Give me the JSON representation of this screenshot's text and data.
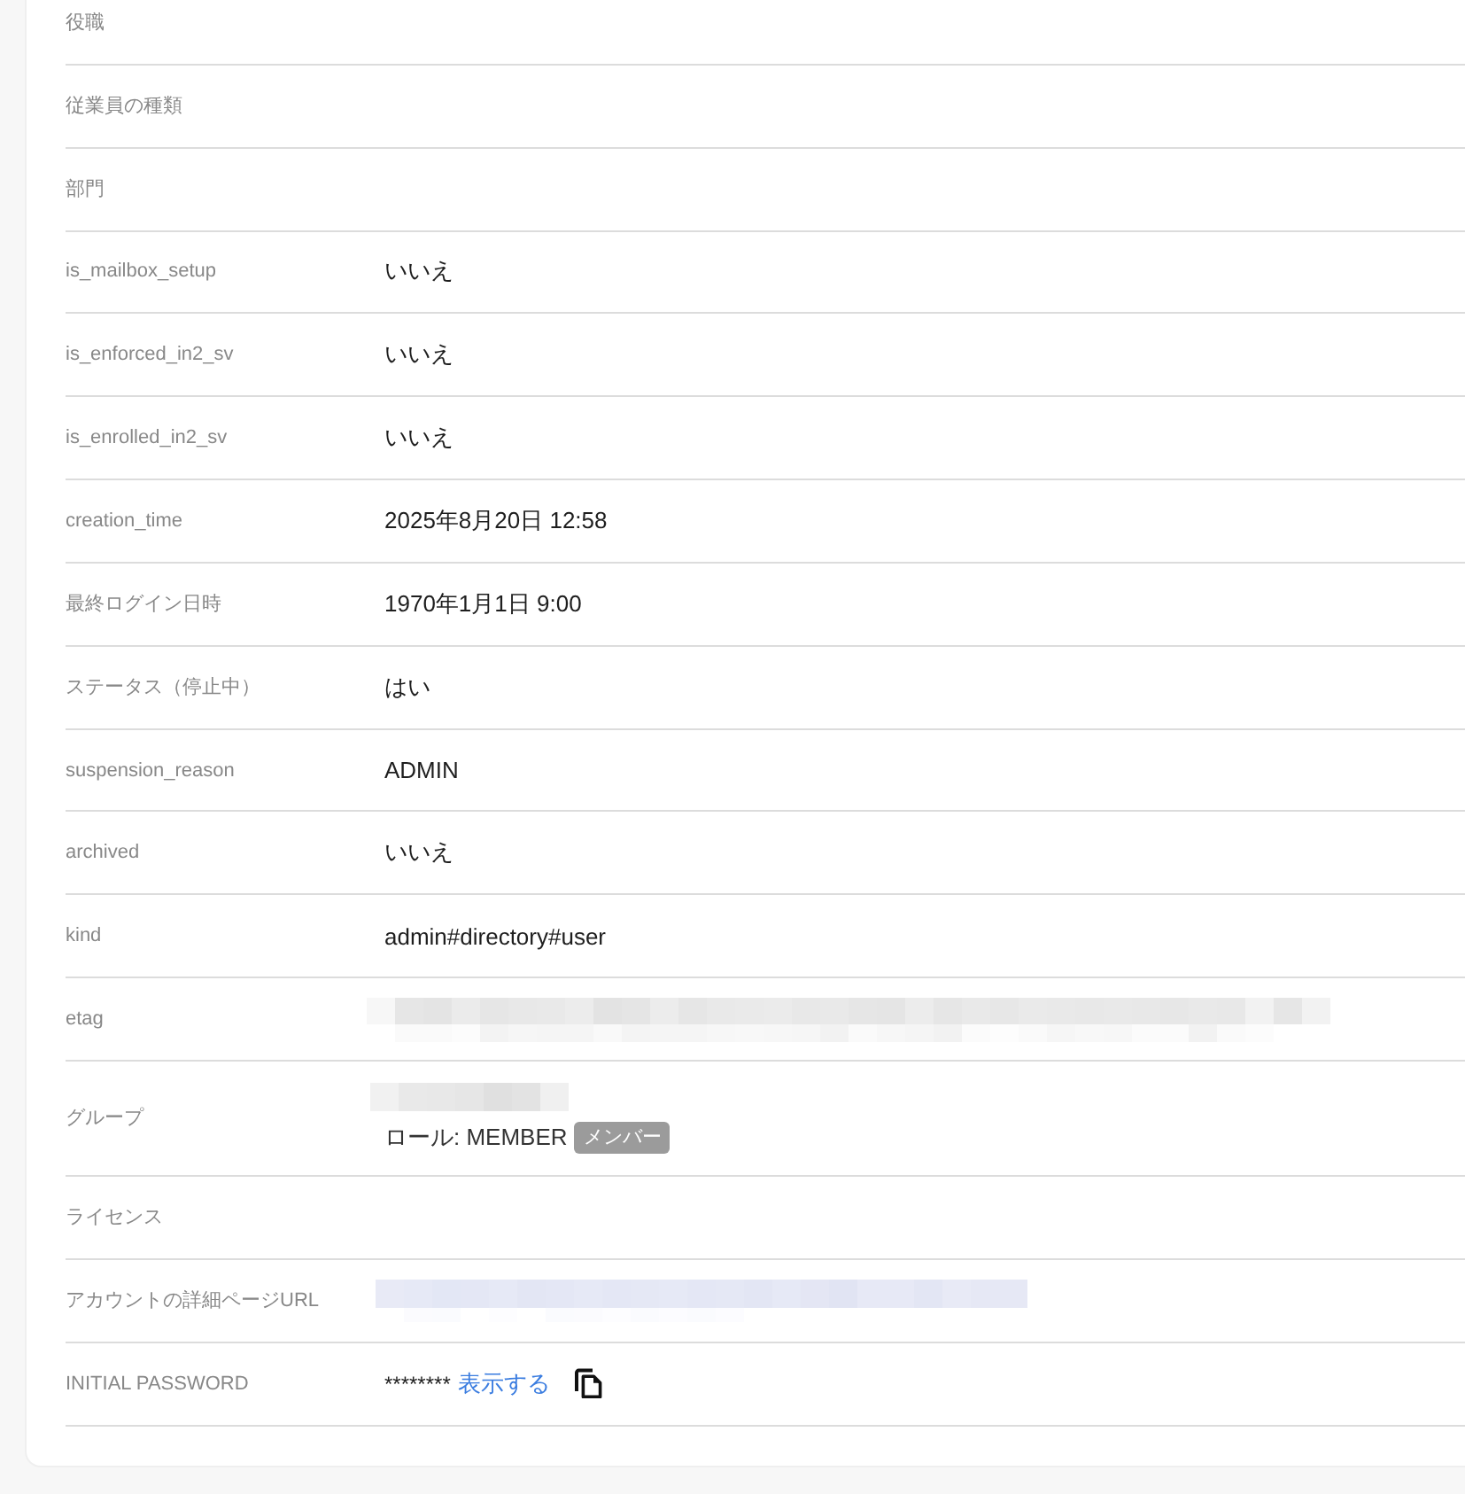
{
  "rows": [
    {
      "kind": "text",
      "label": "役職"
    },
    {
      "kind": "text",
      "label": "従業員の種類"
    },
    {
      "kind": "text",
      "label": "部門"
    },
    {
      "kind": "text",
      "label": "is_mailbox_setup",
      "value": "いいえ"
    },
    {
      "kind": "text",
      "label": "is_enforced_in2_sv",
      "value": "いいえ"
    },
    {
      "kind": "text",
      "label": "is_enrolled_in2_sv",
      "value": "いいえ"
    },
    {
      "kind": "text",
      "label": "creation_time",
      "value": "2025年8月20日 12:58"
    },
    {
      "kind": "text",
      "label": "最終ログイン日時",
      "value": "1970年1月1日 9:00"
    },
    {
      "kind": "text",
      "label": "ステータス（停止中）",
      "value": "はい"
    },
    {
      "kind": "text",
      "label": "suspension_reason",
      "value": "ADMIN"
    },
    {
      "kind": "text",
      "label": "archived",
      "value": "いいえ"
    },
    {
      "kind": "text",
      "label": "kind",
      "value": "admin#directory#user"
    },
    {
      "kind": "blur",
      "label": "etag"
    },
    {
      "kind": "group",
      "label": "グループ",
      "role": "ロール: MEMBER",
      "badge": "メンバー"
    },
    {
      "kind": "text",
      "label": "ライセンス"
    },
    {
      "kind": "url",
      "label": "アカウントの詳細ページURL"
    },
    {
      "kind": "secret",
      "label": "INITIAL PASSWORD",
      "value": "********",
      "link": "表示する"
    }
  ]
}
